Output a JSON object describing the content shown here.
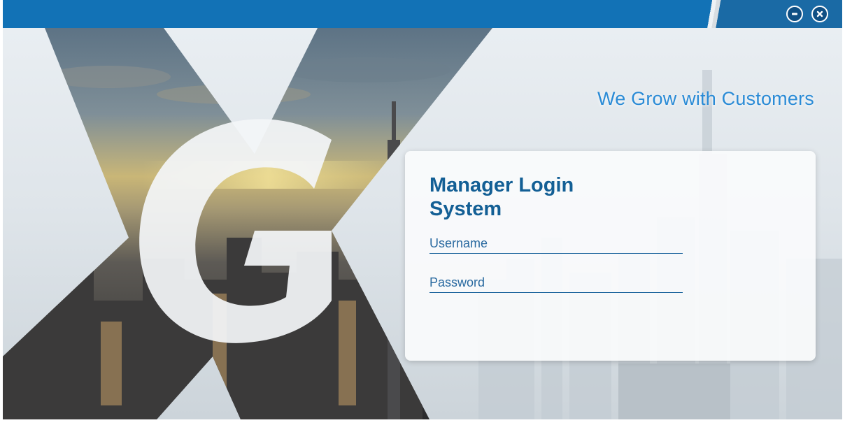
{
  "window": {
    "controls": [
      {
        "name": "minimize",
        "icon": "minus-circle-icon"
      },
      {
        "name": "close",
        "icon": "x-circle-icon"
      }
    ]
  },
  "hero": {
    "tagline": "We Grow with Customers",
    "logo_letters": "XG"
  },
  "login": {
    "title": "Manager Login System",
    "username_placeholder": "Username",
    "password_placeholder": "Password"
  },
  "colors": {
    "accent": "#1272b6",
    "title_text": "#135f95",
    "tagline": "#2a8bd6"
  }
}
